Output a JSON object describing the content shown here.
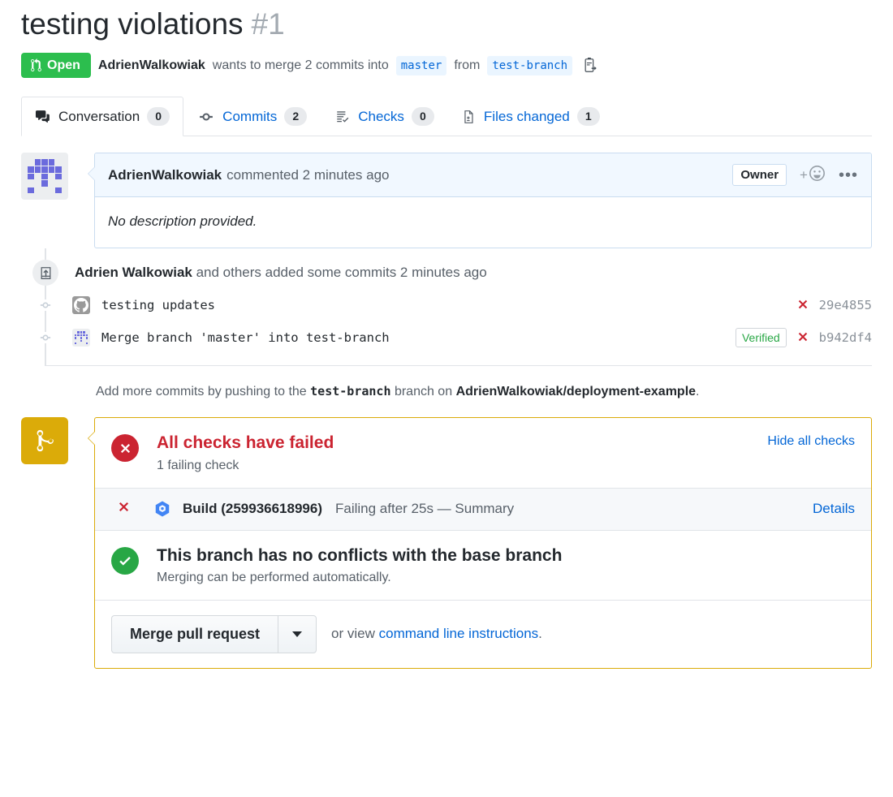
{
  "header": {
    "title": "testing violations",
    "number": "#1",
    "state_label": "Open",
    "state_icon": "git-pull-request-icon",
    "state_color": "#2cbe4e",
    "author": "AdrienWalkowiak",
    "merge_text_1": "wants to merge 2 commits into",
    "base_branch": "master",
    "merge_text_2": "from",
    "head_branch": "test-branch",
    "copy_icon": "copy-branch-icon"
  },
  "tabs": [
    {
      "label": "Conversation",
      "count": "0",
      "icon": "comment-discussion-icon",
      "selected": true
    },
    {
      "label": "Commits",
      "count": "2",
      "icon": "git-commit-icon",
      "selected": false
    },
    {
      "label": "Checks",
      "count": "0",
      "icon": "checklist-icon",
      "selected": false
    },
    {
      "label": "Files changed",
      "count": "1",
      "icon": "file-diff-icon",
      "selected": false
    }
  ],
  "comment": {
    "author": "AdrienWalkowiak",
    "action": "commented 2 minutes ago",
    "owner_badge": "Owner",
    "reaction_plus": "+",
    "reaction_icon": "emoji-smiley-icon",
    "kebab": "•••",
    "body": "No description provided."
  },
  "timeline": {
    "push_badge_icon": "repo-push-icon",
    "push_author": "Adrien Walkowiak",
    "push_text": " and others added some commits 2 minutes ago",
    "commits": [
      {
        "message": "testing updates",
        "avatar": "octocat-avatar",
        "verified": "",
        "status_icon": "x-icon",
        "sha": "29e4855"
      },
      {
        "message": "Merge branch 'master' into test-branch",
        "avatar": "identicon-avatar",
        "verified": "Verified",
        "status_icon": "x-icon",
        "sha": "b942df4"
      }
    ],
    "push_note_prefix": "Add more commits by pushing to the",
    "push_note_branch": "test-branch",
    "push_note_middle": "branch on",
    "push_note_repo": "AdrienWalkowiak/deployment-example",
    "push_note_suffix": "."
  },
  "merge": {
    "merge_icon": "git-merge-icon",
    "merge_icon_color": "#dbab09",
    "checks_status": {
      "icon": "x-circle-icon",
      "color": "#cb2431",
      "heading": "All checks have failed",
      "sub": "1 failing check",
      "toggle_link": "Hide all checks"
    },
    "check_rows": [
      {
        "status_icon": "x-icon",
        "app_icon": "google-cloud-build-icon",
        "name": "Build (259936618996)",
        "description": "Failing after 25s — Summary",
        "details_link": "Details"
      }
    ],
    "conflict_status": {
      "icon": "check-circle-icon",
      "color": "#28a745",
      "heading": "This branch has no conflicts with the base branch",
      "sub": "Merging can be performed automatically."
    },
    "actions": {
      "merge_button": "Merge pull request",
      "dropdown_icon": "chevron-down-icon",
      "or_view_prefix": "or view",
      "cli_link": "command line instructions",
      "or_view_suffix": "."
    }
  }
}
